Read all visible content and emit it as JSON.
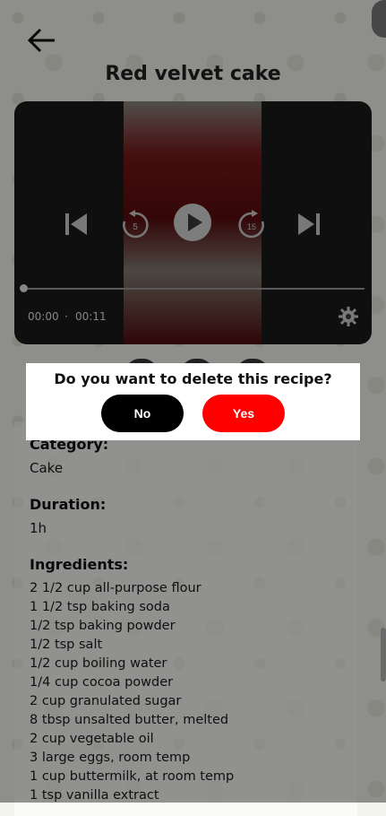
{
  "header": {
    "title": "Red velvet cake",
    "back_icon": "arrow-left-icon"
  },
  "video": {
    "current_time": "00:00",
    "separator": "·",
    "duration": "00:11",
    "progress": 0,
    "controls": [
      "skip-previous-icon",
      "replay-5-icon",
      "play-icon",
      "forward-15-icon",
      "skip-next-icon",
      "gear-icon"
    ],
    "replay_label": "5",
    "forward_label": "15"
  },
  "dialog": {
    "question": "Do you want to delete this recipe?",
    "no_label": "No",
    "yes_label": "Yes",
    "yes_color": "#ff0000",
    "no_color": "#000000"
  },
  "details": {
    "category_label": "Category:",
    "category_value": "Cake",
    "duration_label": "Duration:",
    "duration_value": "1h",
    "ingredients_label": "Ingredients:",
    "ingredients": [
      " 2 1/2 cup all-purpose flour",
      "1 1/2 tsp baking soda",
      "1/2 tsp baking powder",
      "1/2 tsp salt",
      "1/2 cup boiling water",
      "1/4 cup cocoa powder",
      "2 cup granulated sugar",
      "8 tbsp unsalted butter, melted",
      "2 cup vegetable oil",
      "3 large eggs, room temp",
      "1 cup buttermilk, at room temp",
      "1 tsp vanilla extract"
    ]
  }
}
